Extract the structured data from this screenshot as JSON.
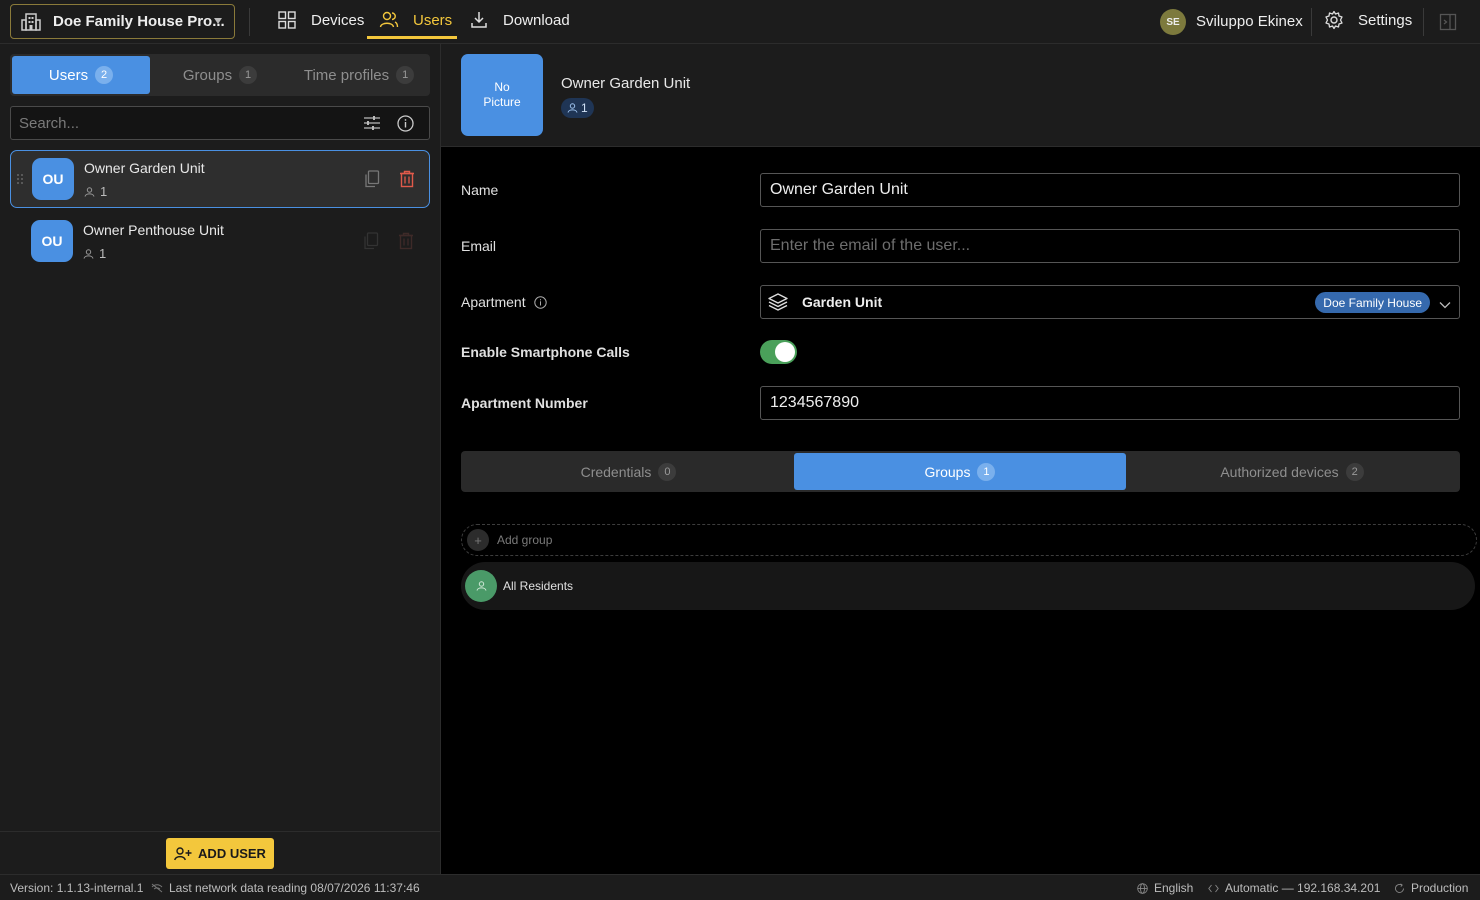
{
  "topbar": {
    "project": "Doe Family House Pro...",
    "nav": {
      "devices": "Devices",
      "users": "Users",
      "download": "Download"
    },
    "user": {
      "initials": "SE",
      "name": "Sviluppo Ekinex"
    },
    "settings": "Settings"
  },
  "sidebar": {
    "tabs": [
      {
        "label": "Users",
        "count": "2"
      },
      {
        "label": "Groups",
        "count": "1"
      },
      {
        "label": "Time profiles",
        "count": "1"
      }
    ],
    "search_placeholder": "Search...",
    "users": [
      {
        "initials": "OU",
        "name": "Owner Garden Unit",
        "count": "1"
      },
      {
        "initials": "OU",
        "name": "Owner Penthouse Unit",
        "count": "1"
      }
    ],
    "add_user": "ADD USER"
  },
  "detail": {
    "picture_text": "No Picture",
    "title": "Owner Garden Unit",
    "group_count": "1",
    "labels": {
      "name": "Name",
      "email": "Email",
      "apartment": "Apartment",
      "smartphone": "Enable Smartphone Calls",
      "apt_number": "Apartment Number"
    },
    "name_value": "Owner Garden Unit",
    "email_placeholder": "Enter the email of the user...",
    "apartment_value": "Garden Unit",
    "apartment_chip": "Doe Family House",
    "smartphone_enabled": true,
    "apt_number_value": "1234567890",
    "tabs": [
      {
        "label": "Credentials",
        "count": "0"
      },
      {
        "label": "Groups",
        "count": "1"
      },
      {
        "label": "Authorized devices",
        "count": "2"
      }
    ],
    "add_group": "Add group",
    "groups": [
      {
        "name": "All Residents"
      }
    ]
  },
  "status": {
    "version": "Version: 1.1.13-internal.1",
    "network": "Last network data reading 08/07/2026 11:37:46",
    "language": "English",
    "connection": "Automatic — 192.168.34.201",
    "environment": "Production"
  },
  "colors": {
    "accent_blue": "#4a90e2",
    "accent_yellow": "#f3c73c",
    "danger": "#e05a4a",
    "toggle_on": "#4aa05a"
  }
}
